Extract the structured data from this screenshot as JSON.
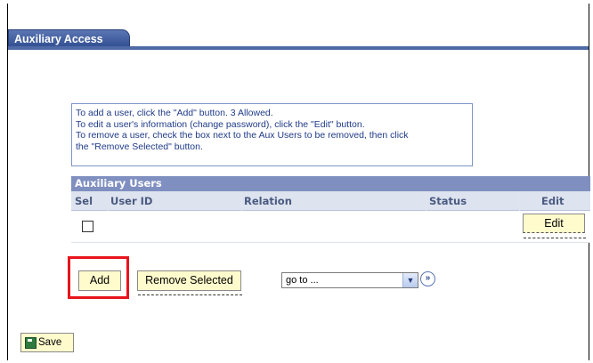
{
  "tab": {
    "label": "Auxiliary Access"
  },
  "instructions": [
    "To add a user, click the \"Add\" button.  3 Allowed.",
    "To edit a user's information (change password), click the \"Edit\" button.",
    "To remove a user, check the box next to the Aux Users to be removed, then click",
    "the \"Remove Selected\" button."
  ],
  "grid": {
    "title": "Auxiliary Users",
    "columns": [
      "Sel",
      "User ID",
      "Relation",
      "Status",
      "Edit"
    ],
    "rows": [
      {
        "selected": false,
        "user_id": "",
        "relation": "",
        "status": "",
        "edit_label": "Edit"
      }
    ]
  },
  "actions": {
    "add_label": "Add",
    "remove_label": "Remove Selected",
    "goto_value": "go to ...",
    "go_icon": "double-chevron-right-icon",
    "highlight_color": "#e8141c"
  },
  "footer": {
    "save_label": "Save",
    "save_icon": "save-disk-icon"
  }
}
